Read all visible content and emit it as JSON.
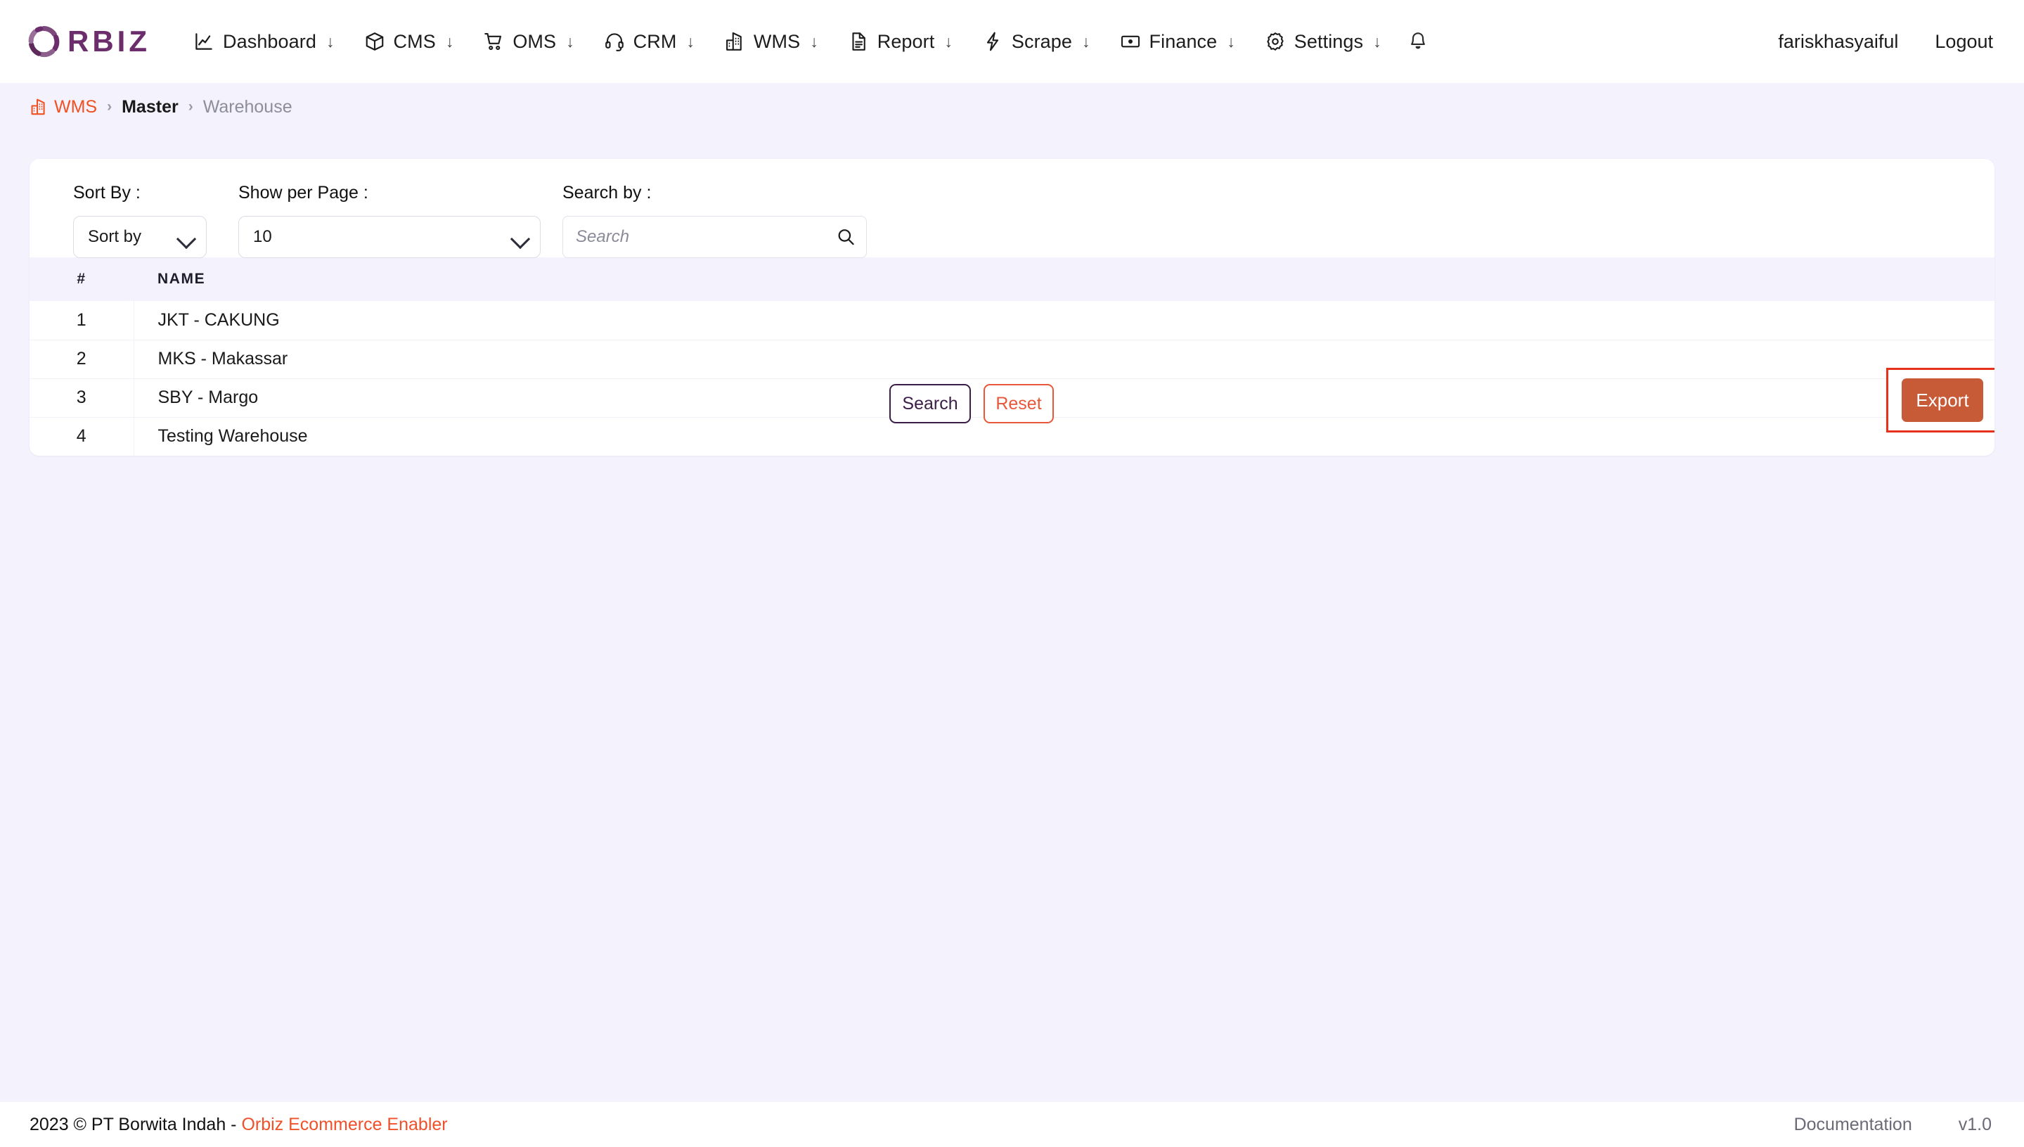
{
  "brand": {
    "logo_icon": "orbiz-ring-logo",
    "name": "RBIZ",
    "full_name": "ORBIZ"
  },
  "nav": {
    "items": [
      {
        "label": "Dashboard",
        "icon": "chart-line-icon",
        "caret": "↓"
      },
      {
        "label": "CMS",
        "icon": "package-box-icon",
        "caret": "↓"
      },
      {
        "label": "OMS",
        "icon": "shopping-cart-icon",
        "caret": "↓"
      },
      {
        "label": "CRM",
        "icon": "headset-icon",
        "caret": "↓"
      },
      {
        "label": "WMS",
        "icon": "warehouse-buildings-icon",
        "caret": "↓"
      },
      {
        "label": "Report",
        "icon": "document-text-icon",
        "caret": "↓"
      },
      {
        "label": "Scrape",
        "icon": "lightning-bolt-icon",
        "caret": "↓"
      },
      {
        "label": "Finance",
        "icon": "banknote-icon",
        "caret": "↓"
      },
      {
        "label": "Settings",
        "icon": "gear-icon",
        "caret": "↓"
      }
    ],
    "notifications_icon": "bell-icon",
    "username": "fariskhasyaiful",
    "logout_label": "Logout"
  },
  "breadcrumb": {
    "home_icon": "warehouse-buildings-icon",
    "home_label": "WMS",
    "separator": "›",
    "middle_label": "Master",
    "current_label": "Warehouse"
  },
  "toolbar": {
    "sort_label": "Sort By :",
    "sort_value": "Sort by",
    "perpage_label": "Show per Page :",
    "perpage_value": "10",
    "searchby_label": "Search by :",
    "search_value": "",
    "search_placeholder": "Search",
    "search_icon": "magnifier-icon",
    "search_button": "Search",
    "reset_button": "Reset",
    "export_button": "Export"
  },
  "table": {
    "columns": [
      "#",
      "NAME"
    ],
    "rows": [
      {
        "num": "1",
        "name": "JKT - CAKUNG"
      },
      {
        "num": "2",
        "name": "MKS - Makassar"
      },
      {
        "num": "3",
        "name": "SBY - Margo"
      },
      {
        "num": "4",
        "name": "Testing Warehouse"
      }
    ]
  },
  "footer": {
    "copyright": "2023 © PT Borwita Indah - ",
    "company_link": "Orbiz Ecommerce Enabler",
    "documentation": "Documentation",
    "version": "v1.0"
  },
  "colors": {
    "page_bg": "#f4f2fc",
    "brand_purple": "#6b2d6b",
    "accent_orange": "#f05122",
    "export_bg": "#c75a37",
    "highlight_red": "#e8311a",
    "search_btn": "#3b1d47",
    "reset_btn": "#e8573a"
  }
}
